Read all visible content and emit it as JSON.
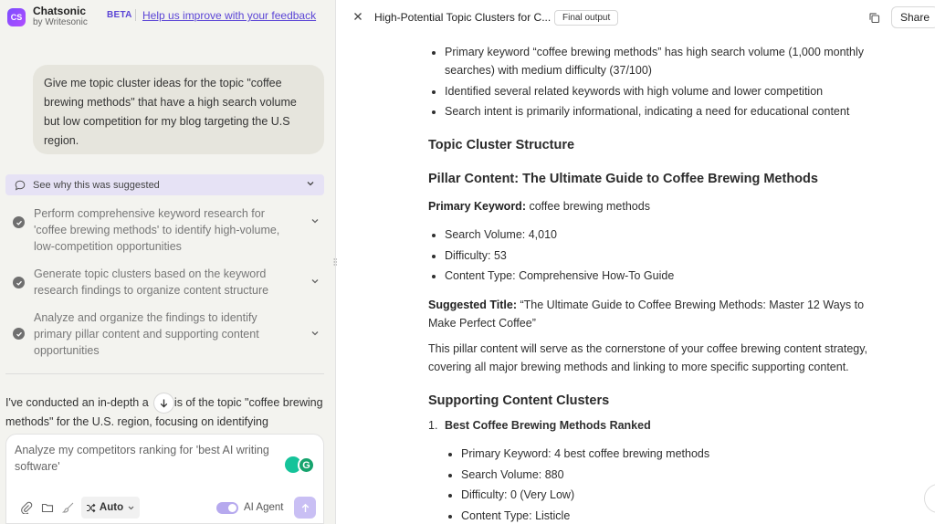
{
  "app": {
    "name": "Chatsonic",
    "by": "by Writesonic",
    "logo_text": "CS",
    "beta": "BETA",
    "feedback_link": "Help us improve with your feedback"
  },
  "chat": {
    "user_message": "Give me topic cluster ideas for the topic \"coffee brewing methods\" that have a high search volume but low competition for my blog targeting the U.S region.",
    "suggest_label": "See why this was suggested",
    "steps": [
      {
        "text": "Perform comprehensive keyword research for 'coffee brewing methods' to identify high-volume, low-competition opportunities"
      },
      {
        "text": "Generate topic clusters based on the keyword research findings to organize content structure"
      },
      {
        "text": "Analyze and organize the findings to identify primary pillar content and supporting content opportunities"
      }
    ],
    "reply_start": "I've conducted an in-depth a",
    "reply_rest": "sis of the topic \"coffee brewing methods\" for the U.S. region, focusing on identifying"
  },
  "composer": {
    "placeholder": "Analyze my competitors ranking for 'best AI writing software'",
    "mode": "Auto",
    "agent_label": "AI Agent"
  },
  "doc": {
    "title": "High-Potential Topic Clusters for C...",
    "tag": "Final output",
    "share": "Share",
    "bullets_top": [
      "Primary keyword “coffee brewing methods” has high search volume (1,000 monthly searches) with medium difficulty (37/100)",
      "Identified several related keywords with high volume and lower competition",
      "Search intent is primarily informational, indicating a need for educational content"
    ],
    "h_structure": "Topic Cluster Structure",
    "h_pillar": "Pillar Content: The Ultimate Guide to Coffee Brewing Methods",
    "primary_kw_label": "Primary Keyword:",
    "primary_kw_value": " coffee brewing methods",
    "pillar_bullets": [
      "Search Volume: 4,010",
      "Difficulty: 53",
      "Content Type: Comprehensive How-To Guide"
    ],
    "suggested_title_label": "Suggested Title:",
    "suggested_title_value": " “The Ultimate Guide to Coffee Brewing Methods: Master 12 Ways to Make Perfect Coffee”",
    "pillar_para": "This pillar content will serve as the cornerstone of your coffee brewing content strategy, covering all major brewing methods and linking to more specific supporting content.",
    "h_supporting": "Supporting Content Clusters",
    "cluster1_num": "1.",
    "cluster1_title": "Best Coffee Brewing Methods Ranked",
    "cluster1_bullets": [
      "Primary Keyword: 4 best coffee brewing methods",
      "Search Volume: 880",
      "Difficulty: 0 (Very Low)",
      "Content Type: Listicle"
    ]
  }
}
